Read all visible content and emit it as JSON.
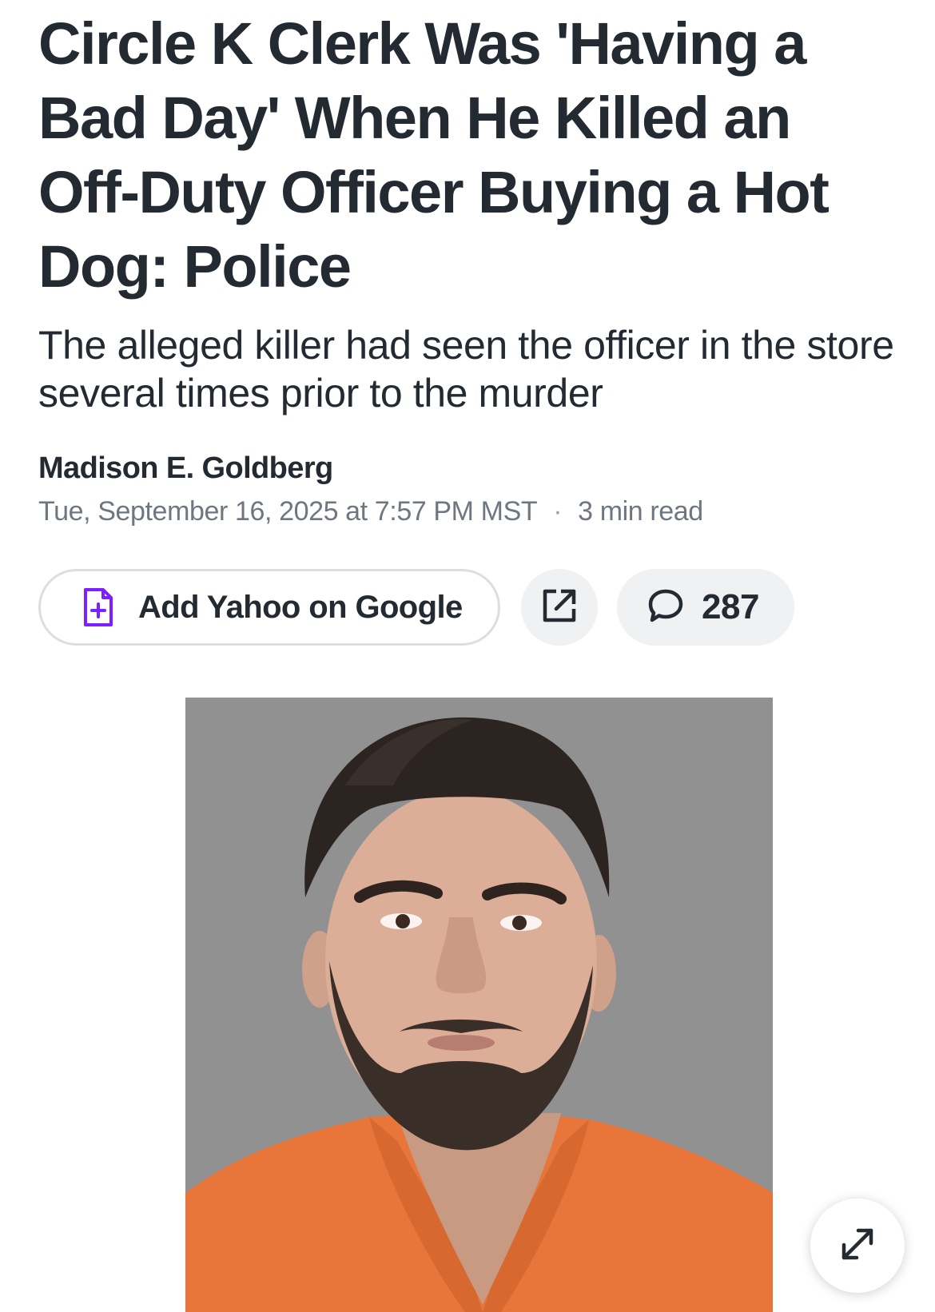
{
  "article": {
    "headline": "Circle K Clerk Was 'Having a Bad Day' When He Killed an Off-Duty Officer Buying a Hot Dog: Police",
    "subheadline": "The alleged killer had seen the officer in the store several times prior to the murder",
    "author": "Madison E. Goldberg",
    "published": "Tue, September 16, 2025 at 7:57 PM MST",
    "separator": "·",
    "read_time": "3 min read"
  },
  "actions": {
    "google_label": "Add Yahoo on Google",
    "google_icon": "document-plus-icon",
    "share_icon": "external-link-icon",
    "comments_icon": "speech-bubble-icon",
    "comment_count": "287"
  },
  "photo": {
    "description_icon": "mugshot-photo",
    "expand_icon": "expand-arrows-icon"
  },
  "colors": {
    "text": "#232a31",
    "muted": "#6e7780",
    "accent_purple": "#7e1fff",
    "pill_bg": "#f0f1f3",
    "jumpsuit_orange": "#e8763a"
  }
}
